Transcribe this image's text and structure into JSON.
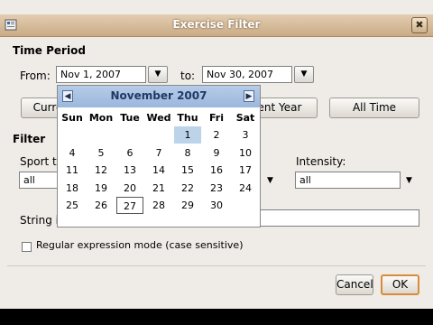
{
  "window": {
    "title": "Exercise Filter",
    "close_glyph": "✖"
  },
  "time_period": {
    "heading": "Time Period",
    "from_label": "From:",
    "from_value": "Nov 1, 2007",
    "to_label": "to:",
    "to_value": "Nov 30, 2007",
    "dropdown_glyph": "▼",
    "buttons": {
      "current": "Curre",
      "current_year": "ent Year",
      "all_time": "All Time"
    }
  },
  "calendar": {
    "month_label": "November 2007",
    "prev_glyph": "◀",
    "next_glyph": "▶",
    "weekdays": [
      "Sun",
      "Mon",
      "Tue",
      "Wed",
      "Thu",
      "Fri",
      "Sat"
    ],
    "days": [
      [
        "",
        "",
        "",
        "",
        "1",
        "2",
        "3"
      ],
      [
        "4",
        "5",
        "6",
        "7",
        "8",
        "9",
        "10"
      ],
      [
        "11",
        "12",
        "13",
        "14",
        "15",
        "16",
        "17"
      ],
      [
        "18",
        "19",
        "20",
        "21",
        "22",
        "23",
        "24"
      ],
      [
        "25",
        "26",
        "27",
        "28",
        "29",
        "30",
        ""
      ]
    ],
    "selected_day": "1",
    "today_day": "27"
  },
  "filter": {
    "heading": "Filter",
    "sport_label": "Sport ty",
    "sport_value": "all",
    "intensity_label": "Intensity:",
    "intensity_value": "all",
    "string_label": "String in",
    "regex_label": "Regular expression mode (case sensitive)"
  },
  "actions": {
    "cancel": "Cancel",
    "ok": "OK"
  },
  "colors": {
    "title_bar": "#c9ab86",
    "calendar_header": "#9bb7dd",
    "selected_day": "#bcd3ea",
    "ok_border": "#d98a3a"
  }
}
